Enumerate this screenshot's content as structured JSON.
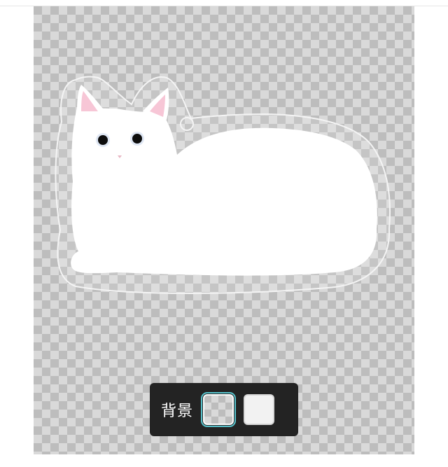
{
  "background_picker": {
    "label": "背景",
    "options": [
      {
        "name": "transparent",
        "selected": true
      },
      {
        "name": "white",
        "selected": false
      }
    ],
    "selected_outline_color": "#58c3cc"
  },
  "artwork": {
    "subject": "white-cat-acrylic-keychain",
    "icon": "cat-icon"
  }
}
